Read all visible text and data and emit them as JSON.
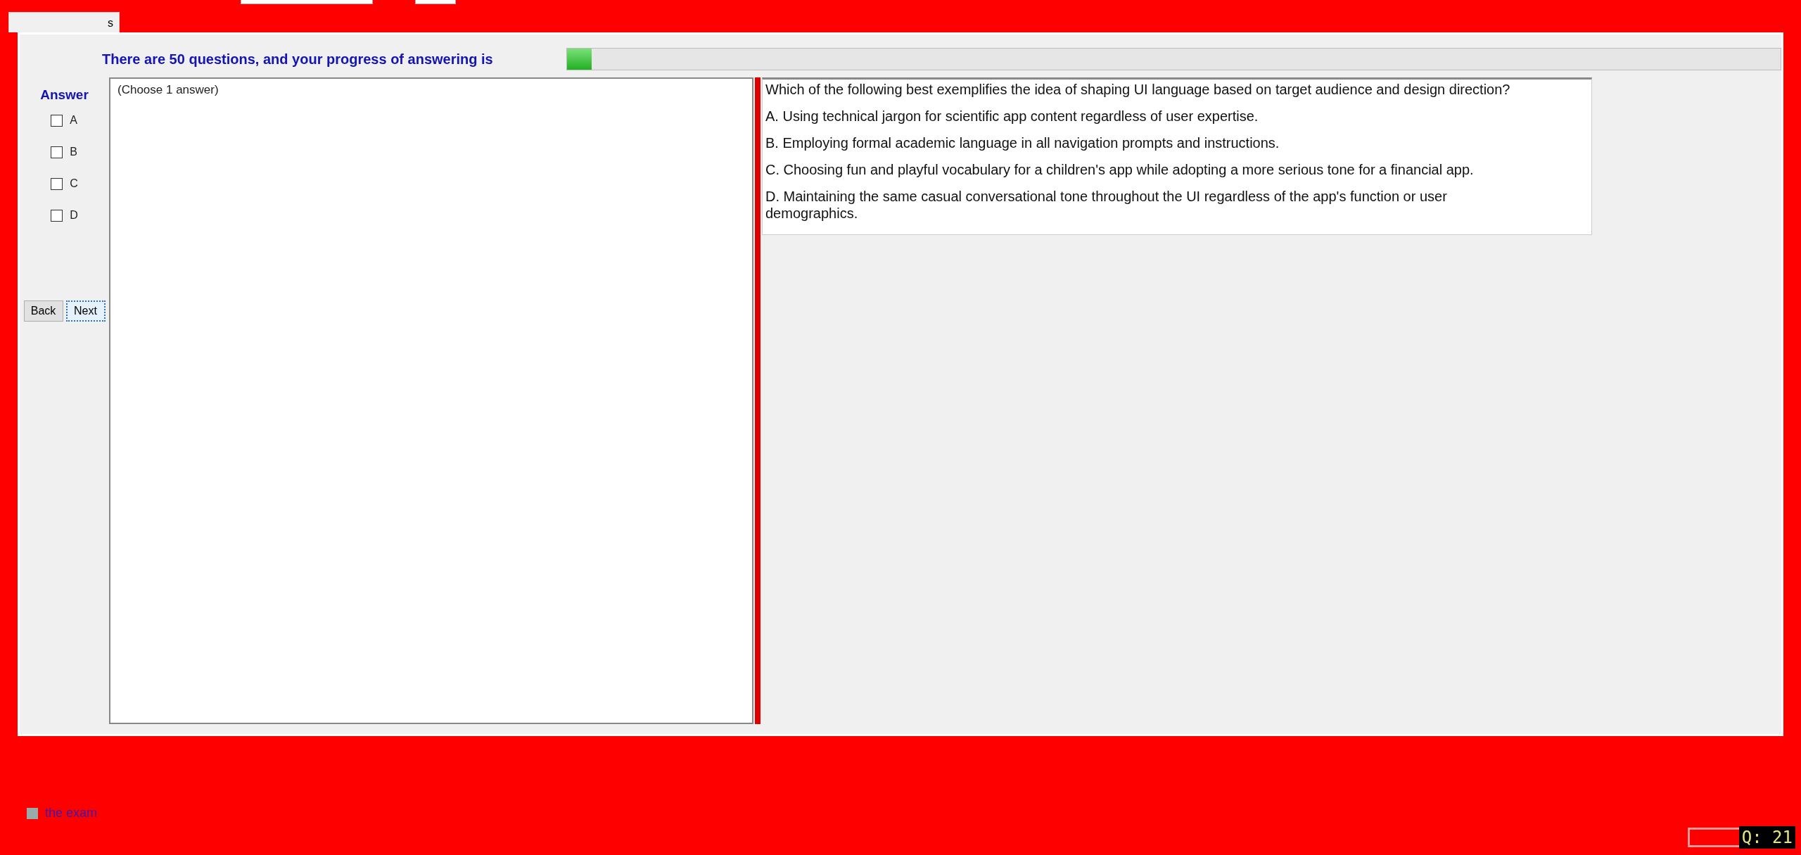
{
  "tab": {
    "label": "s"
  },
  "progress": {
    "label": "There are 50 questions, and your progress of answering is",
    "level": 0.02
  },
  "answer": {
    "title": "Answer",
    "options": [
      {
        "label": "A",
        "checked": false
      },
      {
        "label": "B",
        "checked": false
      },
      {
        "label": "C",
        "checked": false
      },
      {
        "label": "D",
        "checked": false
      }
    ]
  },
  "buttons": [
    {
      "label": "Back",
      "focused": false
    },
    {
      "label": "Next",
      "focused": true
    }
  ],
  "answer_hint": "(Choose 1 answer)",
  "question": {
    "text": "Which of the following best exemplifies the idea of shaping UI language based on target audience and design direction?",
    "choices": [
      "A.  Using technical jargon for scientific app content regardless of user expertise.",
      "B.  Employing formal academic language in all navigation prompts and instructions.",
      "C.  Choosing fun and playful vocabulary for a children's app while adopting a more serious tone for a financial app.",
      "D.  Maintaining the same casual conversational tone throughout the UI regardless of the app's function or user demographics."
    ]
  },
  "finish": {
    "label": "the exam",
    "checked": false
  },
  "question_counter": "Q: 21"
}
